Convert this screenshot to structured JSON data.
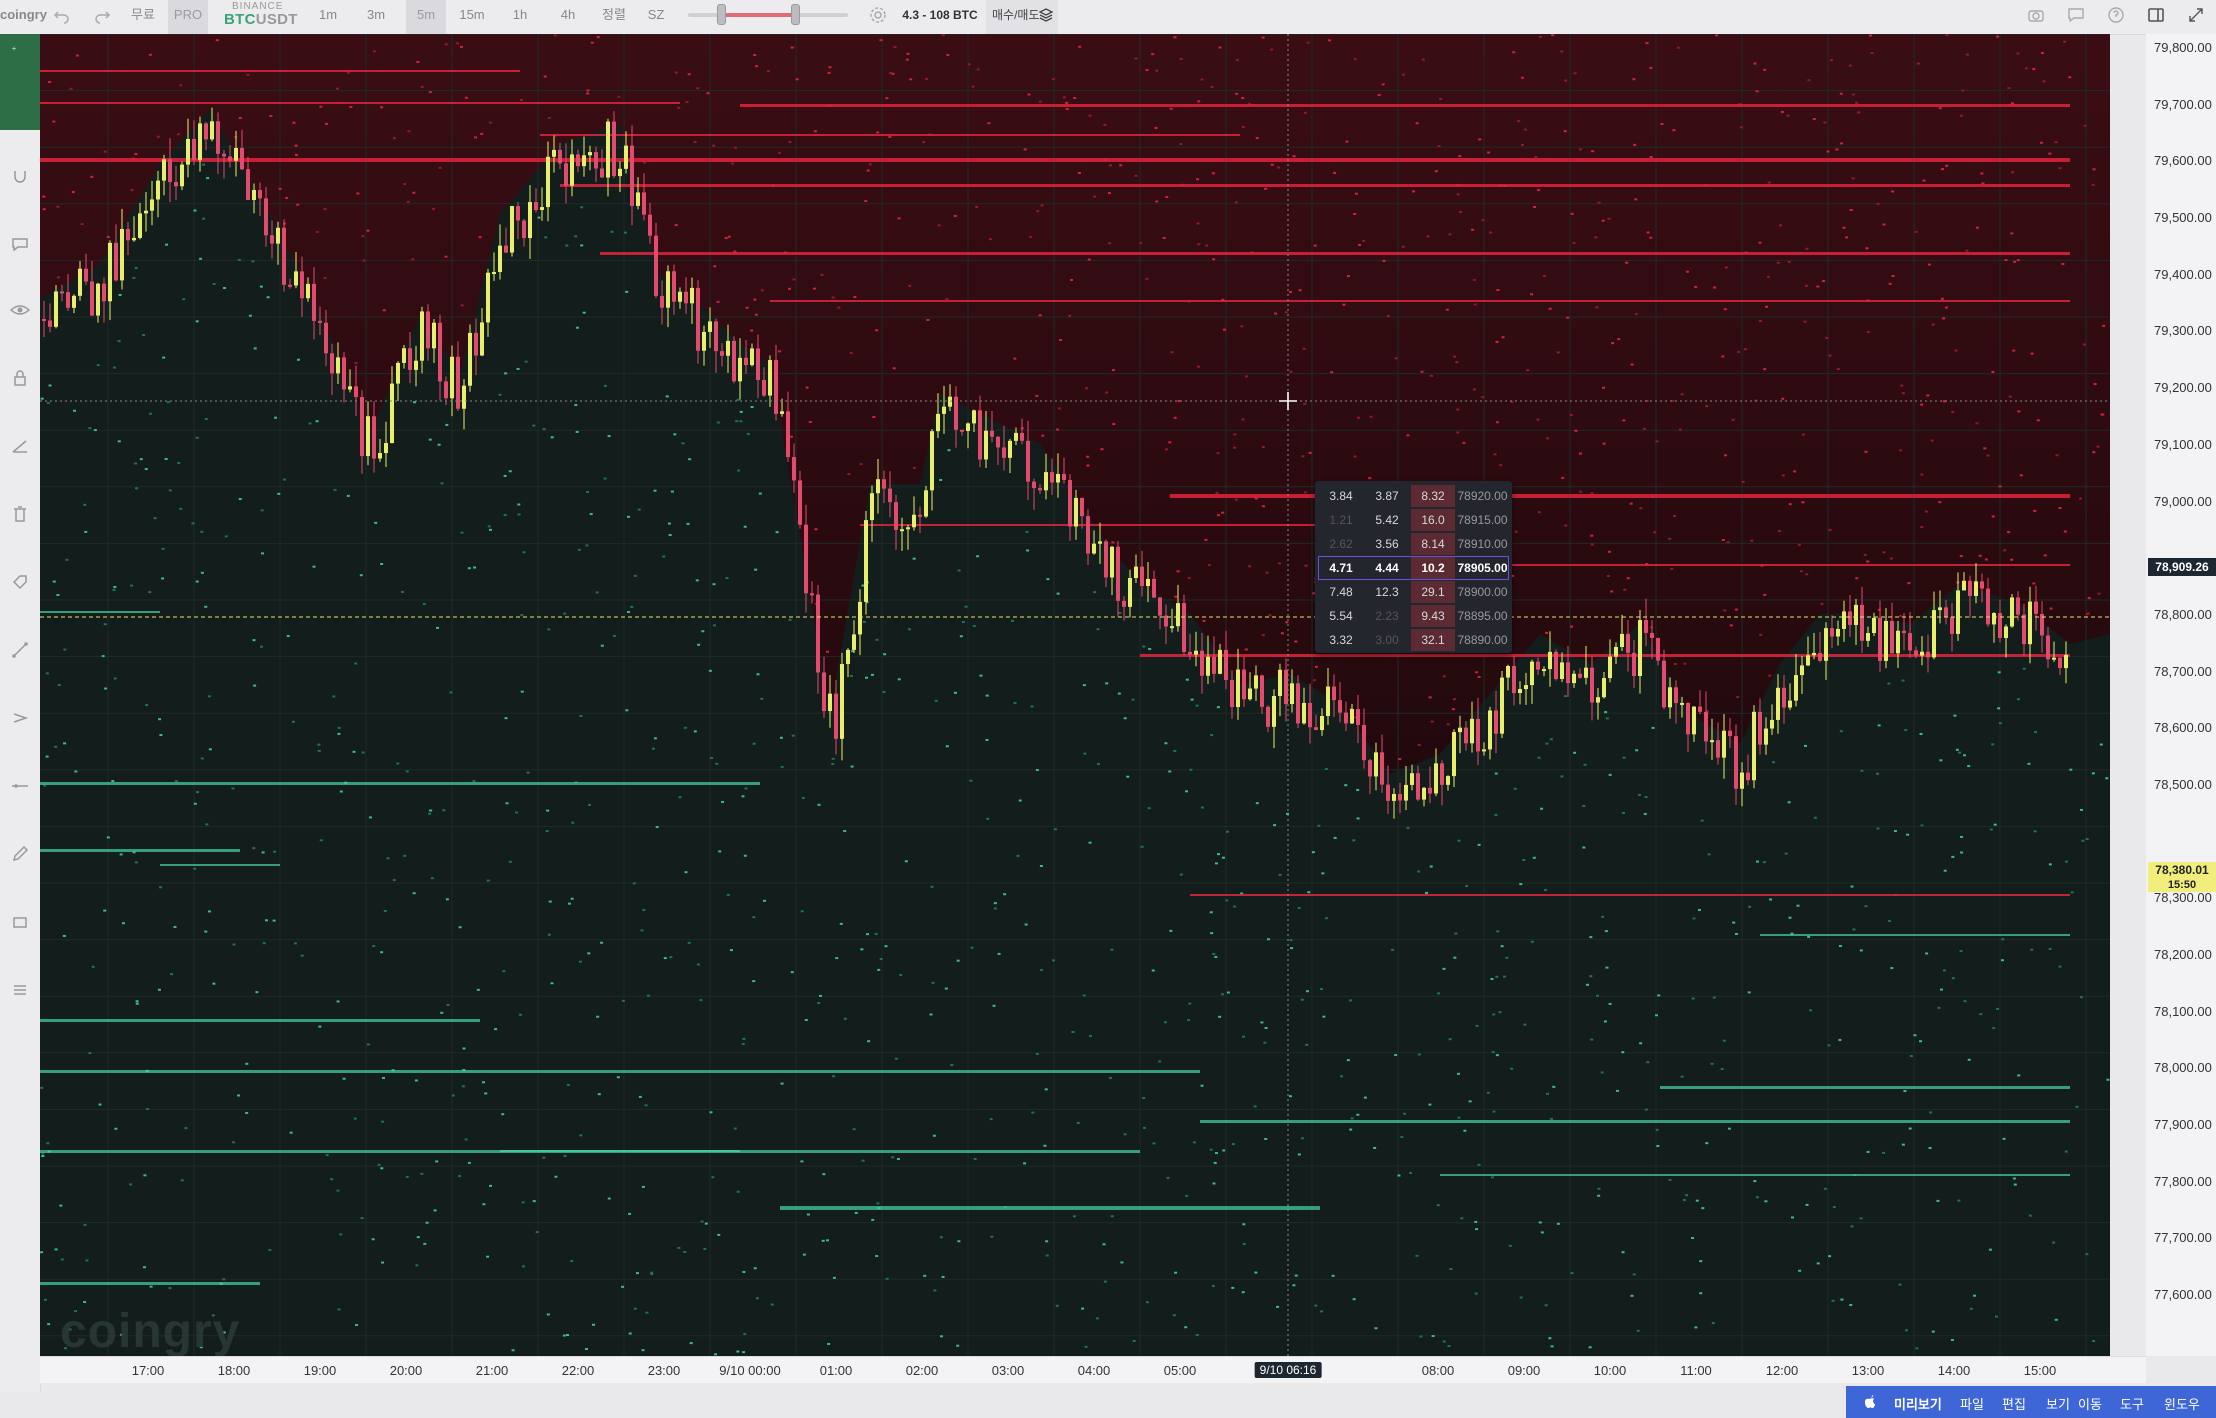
{
  "toolbar": {
    "logo": "coingry",
    "free": "무료",
    "pro": "PRO",
    "exchange": "BINANCE",
    "symbol_base": "BTC",
    "symbol_quote": "USDT",
    "intervals": [
      "1m",
      "3m",
      "5m",
      "15m",
      "1h",
      "4h",
      "정렬",
      "SZ"
    ],
    "active_interval": "5m",
    "size_range": "4.3 - 108 BTC",
    "side_label": "매수/매도",
    "colors": {
      "accent_green": "#3aa37a",
      "ask_red": "#e0243d",
      "bid_green": "#47d6a4"
    }
  },
  "left_tools": [
    "crosshair-icon",
    "magnet-icon",
    "comment-icon",
    "eye-icon",
    "lock-icon",
    "ruler-icon",
    "trash-icon",
    "tag-icon",
    "trend-line-icon",
    "ray-icon",
    "horizontal-line-icon",
    "pencil-icon",
    "rectangle-icon",
    "menu-icon"
  ],
  "price_axis": {
    "labels": [
      "79,800.00",
      "79,700.00",
      "79,600.00",
      "79,500.00",
      "79,400.00",
      "79,300.00",
      "79,200.00",
      "79,100.00",
      "79,000.00",
      "78,800.00",
      "78,700.00",
      "78,600.00",
      "78,500.00",
      "78,300.00",
      "78,200.00",
      "78,100.00",
      "78,000.00",
      "77,900.00",
      "77,800.00",
      "77,700.00",
      "77,600.00"
    ],
    "crosshair_price": "78,909.26",
    "last_price": "78,380.01",
    "countdown": "15:50"
  },
  "time_axis": {
    "labels": [
      "17:00",
      "18:00",
      "19:00",
      "20:00",
      "21:00",
      "22:00",
      "23:00",
      "9/10 00:00",
      "01:00",
      "02:00",
      "03:00",
      "04:00",
      "05:00",
      "08:00",
      "09:00",
      "10:00",
      "11:00",
      "12:00",
      "13:00",
      "14:00",
      "15:00"
    ],
    "crosshair_time": "9/10 06:16"
  },
  "orderbook": {
    "rows": [
      {
        "bid": "3.84",
        "mid": "3.87",
        "ask": "8.32",
        "price": "78920.00"
      },
      {
        "bid": "1.21",
        "mid": "5.42",
        "ask": "16.0",
        "price": "78915.00"
      },
      {
        "bid": "2.62",
        "mid": "3.56",
        "ask": "8.14",
        "price": "78910.00"
      },
      {
        "bid": "4.71",
        "mid": "4.44",
        "ask": "10.2",
        "price": "78905.00"
      },
      {
        "bid": "7.48",
        "mid": "12.3",
        "ask": "29.1",
        "price": "78900.00"
      },
      {
        "bid": "5.54",
        "mid": "2.23",
        "ask": "9.43",
        "price": "78895.00"
      },
      {
        "bid": "3.32",
        "mid": "3.00",
        "ask": "32.1",
        "price": "78890.00"
      }
    ]
  },
  "watermark": "coingry",
  "menubar": {
    "items": [
      "미리보기",
      "파일",
      "편집",
      "보기",
      "이동",
      "도구",
      "윈도우"
    ]
  }
}
